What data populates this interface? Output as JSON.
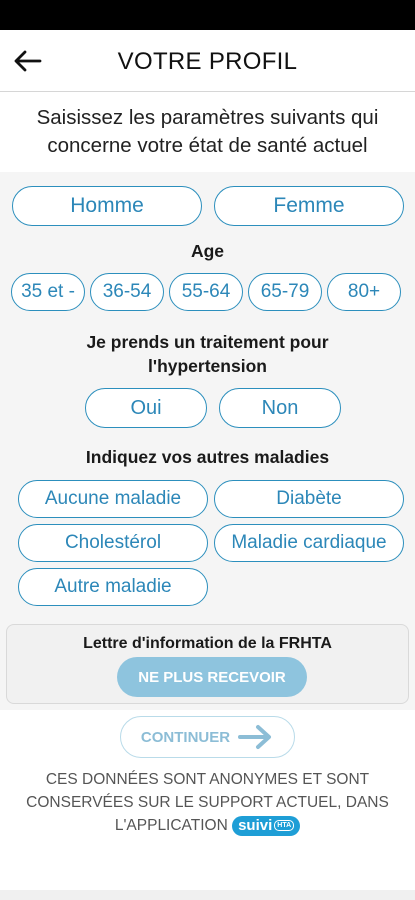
{
  "header": {
    "title": "VOTRE PROFIL",
    "back_icon": "arrow-left-icon"
  },
  "intro": {
    "line1": "Saisissez les paramètres suivants qui",
    "line2": "concerne votre état de santé actuel"
  },
  "gender": {
    "options": [
      "Homme",
      "Femme"
    ]
  },
  "age": {
    "label": "Age",
    "options": [
      "35 et -",
      "36-54",
      "55-64",
      "65-79",
      "80+"
    ]
  },
  "hypertension": {
    "label_line1": "Je prends un traitement pour",
    "label_line2": "l'hypertension",
    "options": [
      "Oui",
      "Non"
    ]
  },
  "diseases": {
    "label": "Indiquez vos autres maladies",
    "options": [
      "Aucune maladie",
      "Diabète",
      "Cholestérol",
      "Maladie cardiaque",
      "Autre maladie"
    ]
  },
  "newsletter": {
    "title": "Lettre d'information de la FRHTA",
    "button": "NE PLUS RECEVOIR"
  },
  "continue_button": {
    "label": "CONTINUER",
    "icon": "arrow-right-icon"
  },
  "footer": {
    "line1": "CES DONNÉES SONT ANONYMES ET SONT",
    "line2": "CONSERVÉES SUR LE SUPPORT ACTUEL, DANS",
    "line3": "L'APPLICATION",
    "logo_text": "suivi",
    "logo_sub": "HTA"
  },
  "colors": {
    "accent": "#2c8fbd",
    "button_fill": "#8ec4de",
    "panel": "#f5f5f5"
  }
}
